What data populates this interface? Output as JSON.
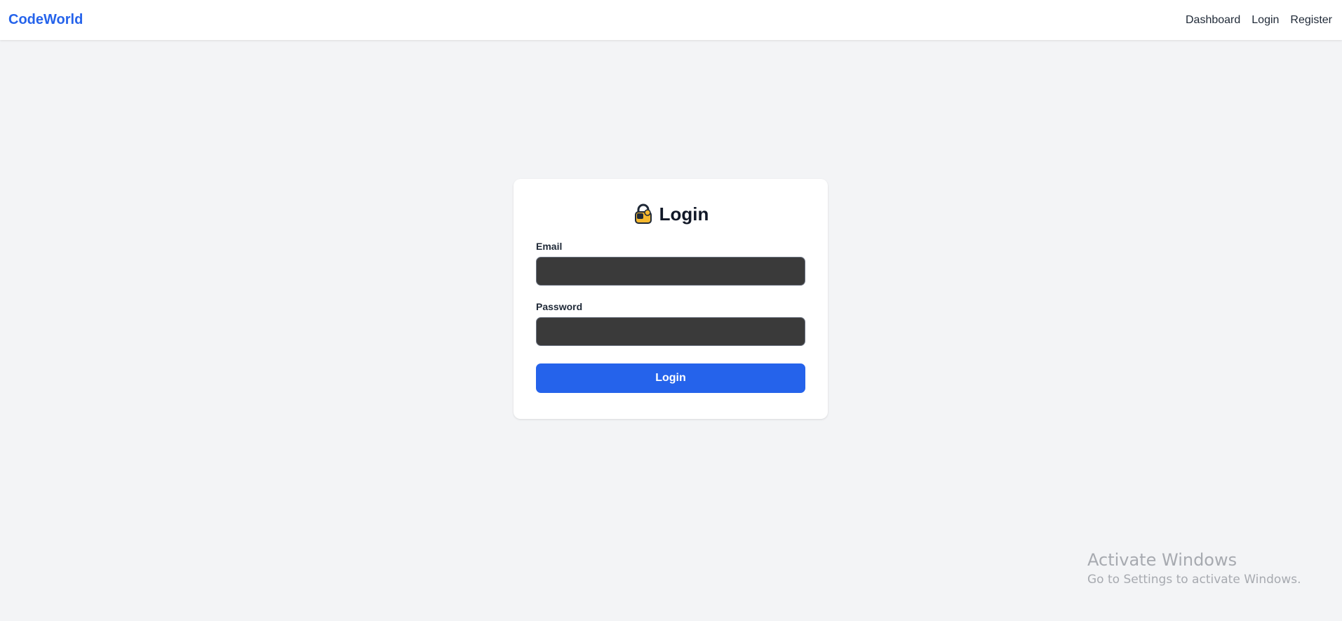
{
  "navbar": {
    "brand": "CodeWorld",
    "links": [
      {
        "label": "Dashboard"
      },
      {
        "label": "Login"
      },
      {
        "label": "Register"
      }
    ]
  },
  "login_form": {
    "title_icon": "lock-icon",
    "title": "Login",
    "email_label": "Email",
    "email_value": "",
    "password_label": "Password",
    "password_value": "",
    "submit_label": "Login"
  },
  "watermark": {
    "title": "Activate Windows",
    "subtitle": "Go to Settings to activate Windows."
  },
  "colors": {
    "brand": "#2563eb",
    "background": "#f3f4f6",
    "input_fill": "#3a3a3a",
    "button": "#2563eb"
  }
}
